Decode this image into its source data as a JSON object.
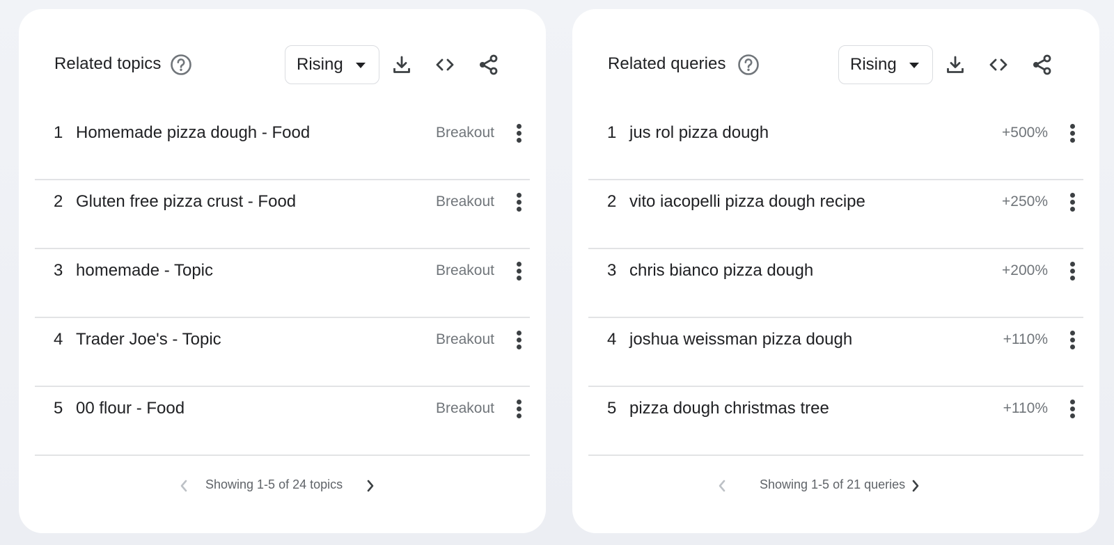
{
  "panels": [
    {
      "title": "Related topics",
      "dropdown": {
        "selected": "Rising"
      },
      "rows": [
        {
          "rank": "1",
          "label": "Homemade pizza dough - Food",
          "value": "Breakout"
        },
        {
          "rank": "2",
          "label": "Gluten free pizza crust - Food",
          "value": "Breakout"
        },
        {
          "rank": "3",
          "label": "homemade - Topic",
          "value": "Breakout"
        },
        {
          "rank": "4",
          "label": "Trader Joe's - Topic",
          "value": "Breakout"
        },
        {
          "rank": "5",
          "label": "00 flour - Food",
          "value": "Breakout"
        }
      ],
      "pager": "Showing 1-5 of 24 topics"
    },
    {
      "title": "Related queries",
      "dropdown": {
        "selected": "Rising"
      },
      "rows": [
        {
          "rank": "1",
          "label": "jus rol pizza dough",
          "value": "+500%"
        },
        {
          "rank": "2",
          "label": "vito iacopelli pizza dough recipe",
          "value": "+250%"
        },
        {
          "rank": "3",
          "label": "chris bianco pizza dough",
          "value": "+200%"
        },
        {
          "rank": "4",
          "label": "joshua weissman pizza dough",
          "value": "+110%"
        },
        {
          "rank": "5",
          "label": "pizza dough christmas tree",
          "value": "+110%"
        }
      ],
      "pager": "Showing 1-5 of 21 queries"
    }
  ],
  "icons": {
    "help": "help-circle-icon",
    "download": "download-icon",
    "embed": "code-embed-icon",
    "share": "share-icon",
    "more": "more-vertical-icon",
    "prev": "chevron-left-icon",
    "next": "chevron-right-icon"
  },
  "colors": {
    "background": "#f1f3f7",
    "card": "#ffffff",
    "text_primary": "#202124",
    "text_secondary": "#70757a",
    "divider": "#e2e3e5",
    "icon": "#3c4043",
    "disabled": "#bdc1c6"
  }
}
